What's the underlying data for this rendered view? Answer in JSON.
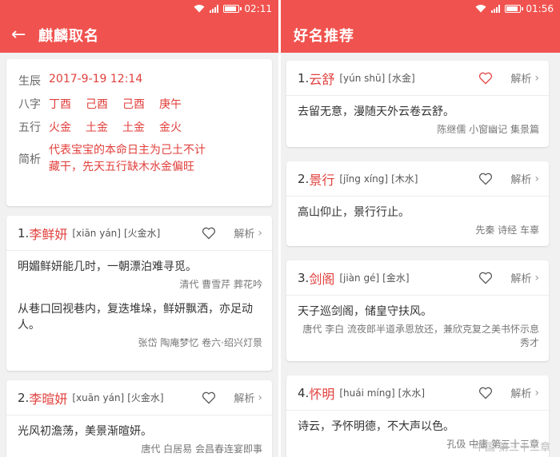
{
  "left": {
    "status": {
      "time": "02:11"
    },
    "appbar": {
      "back_icon": "arrow-left-icon",
      "title": "麒麟取名"
    },
    "info": {
      "birth_label": "生辰",
      "birth_value": "2017-9-19 12:14",
      "bazi_label": "八字",
      "bazi": [
        "丁酉",
        "己酉",
        "己酉",
        "庚午"
      ],
      "wuxing_label": "五行",
      "wuxing": [
        "火金",
        "土金",
        "土金",
        "金火"
      ],
      "analysis_label": "简析",
      "analysis": "代表宝宝的本命日主为己土不计藏干，先天五行缺木水金偏旺"
    },
    "names": [
      {
        "num": "1.",
        "name": "李鲜妍",
        "pinyin": "[xiān yán]",
        "wuxing": "[火金水]",
        "action": "解析",
        "quotes": [
          {
            "text": "明媚鲜妍能几时，一朝漂泊难寻觅。",
            "source": "清代 曹雪芹 葬花吟"
          },
          {
            "text": "从巷口回视巷内，复迭堆垛，鲜妍飘洒，亦足动人。",
            "source": "张岱 陶庵梦忆 卷六·绍兴灯景"
          }
        ]
      },
      {
        "num": "2.",
        "name": "李暄妍",
        "pinyin": "[xuān yán]",
        "wuxing": "[火金水]",
        "action": "解析",
        "quotes": [
          {
            "text": "光风初澹荡，美景渐暄妍。",
            "source": "唐代 白居易 会昌春连宴即事"
          }
        ]
      }
    ]
  },
  "right": {
    "status": {
      "time": "01:56"
    },
    "appbar": {
      "title": "好名推荐"
    },
    "names": [
      {
        "num": "1.",
        "name": "云舒",
        "pinyin": "[yún shū]",
        "wuxing": "[水金]",
        "action": "解析",
        "favorited": false,
        "text": "去留无意，漫随天外云卷云舒。",
        "source": "陈继儒 小窗幽记 集景篇"
      },
      {
        "num": "2.",
        "name": "景行",
        "pinyin": "[jǐng xíng]",
        "wuxing": "[木水]",
        "action": "解析",
        "favorited": false,
        "text": "高山仰止，景行行止。",
        "source": "先秦 诗经 车辜"
      },
      {
        "num": "3.",
        "name": "剑阁",
        "pinyin": "[jiàn gé]",
        "wuxing": "[金水]",
        "action": "解析",
        "favorited": false,
        "text": "天子巡剑阁，储皇守扶风。",
        "source": "唐代 李白 流夜郎半道承恩放还，兼欣克复之美书怀示息秀才"
      },
      {
        "num": "4.",
        "name": "怀明",
        "pinyin": "[huái míng]",
        "wuxing": "[水水]",
        "action": "解析",
        "favorited": false,
        "text": "诗云，予怀明德，不大声以色。",
        "source": "孔伋 中庸 第三十三章"
      }
    ],
    "watermark": "中国 第三十三章"
  },
  "colors": {
    "accent": "#f0534f",
    "name_red": "#e0403c"
  }
}
